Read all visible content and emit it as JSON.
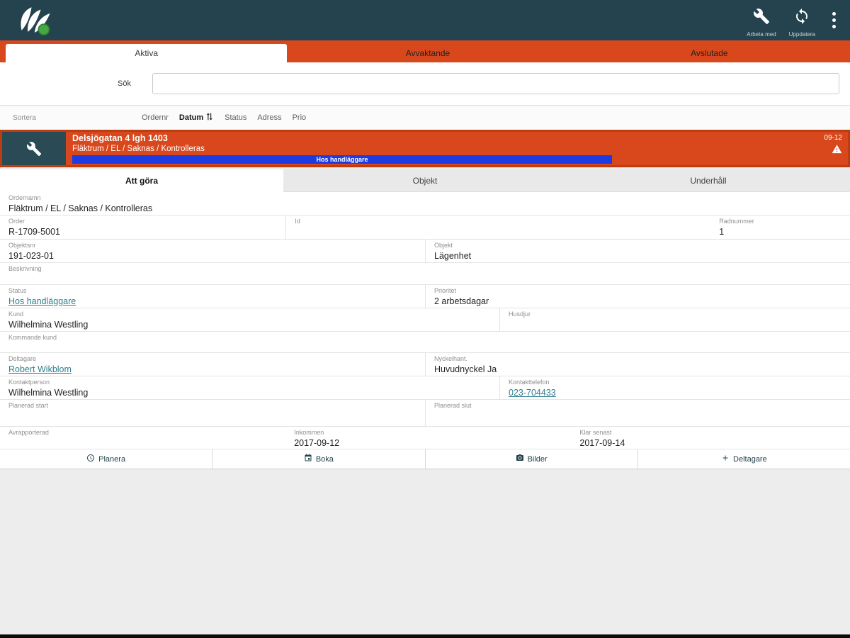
{
  "topbar": {
    "actions": [
      {
        "label": "Arbeta med",
        "icon": "wrench-icon"
      },
      {
        "label": "Uppdatera",
        "icon": "refresh-icon"
      }
    ]
  },
  "tabs": [
    {
      "label": "Aktiva",
      "active": true
    },
    {
      "label": "Avvaktande",
      "active": false
    },
    {
      "label": "Avslutade",
      "active": false
    }
  ],
  "search": {
    "label": "Sök",
    "value": ""
  },
  "sort": {
    "label": "Sortera",
    "options": [
      {
        "label": "Ordernr",
        "active": false
      },
      {
        "label": "Datum",
        "active": true
      },
      {
        "label": "Status",
        "active": false
      },
      {
        "label": "Adress",
        "active": false
      },
      {
        "label": "Prio",
        "active": false
      }
    ]
  },
  "order_card": {
    "title": "Delsjögatan 4 lgh 1403",
    "subtitle": "Fläktrum / EL / Saknas / Kontrolleras",
    "status_bar": "Hos handläggare",
    "date": "09-12"
  },
  "detail_tabs": [
    {
      "label": "Att göra",
      "active": true
    },
    {
      "label": "Objekt",
      "active": false
    },
    {
      "label": "Underhåll",
      "active": false
    }
  ],
  "fields": {
    "ordernamn": {
      "label": "Ordernamn",
      "value": "Fläktrum / EL / Saknas / Kontrolleras"
    },
    "order": {
      "label": "Order",
      "value": "R-1709-5001"
    },
    "id": {
      "label": "Id",
      "value": ""
    },
    "radnummer": {
      "label": "Radnummer",
      "value": "1"
    },
    "objektsnr": {
      "label": "Objektsnr",
      "value": "191-023-01"
    },
    "objekt": {
      "label": "Objekt",
      "value": "Lägenhet"
    },
    "beskrivning": {
      "label": "Beskrivning",
      "value": ""
    },
    "status": {
      "label": "Status",
      "value": "Hos handläggare"
    },
    "prioritet": {
      "label": "Prioritet",
      "value": "2 arbetsdagar"
    },
    "kund": {
      "label": "Kund",
      "value": "Wilhelmina Westling"
    },
    "husdjur": {
      "label": "Husdjur",
      "value": ""
    },
    "kommande_kund": {
      "label": "Kommande kund",
      "value": ""
    },
    "deltagare": {
      "label": "Deltagare",
      "value": "Robert Wikblom"
    },
    "nyckelhant": {
      "label": "Nyckelhant.",
      "value": "Huvudnyckel Ja"
    },
    "kontaktperson": {
      "label": "Kontaktperson",
      "value": "Wilhelmina Westling"
    },
    "kontakttelefon": {
      "label": "Kontakttelefon",
      "value": "023-704433"
    },
    "planerad_start": {
      "label": "Planerad start",
      "value": ""
    },
    "planerad_slut": {
      "label": "Planerad slut",
      "value": ""
    },
    "avrapporterad": {
      "label": "Avrapporterad",
      "value": ""
    },
    "inkommen": {
      "label": "Inkommen",
      "value": "2017-09-12"
    },
    "klar_senast": {
      "label": "Klar senast",
      "value": "2017-09-14"
    }
  },
  "action_buttons": [
    {
      "label": "Planera",
      "icon": "clock-icon"
    },
    {
      "label": "Boka",
      "icon": "calendar-icon"
    },
    {
      "label": "Bilder",
      "icon": "camera-icon"
    },
    {
      "label": "Deltagare",
      "icon": "plus-icon"
    }
  ],
  "colors": {
    "topbar": "#24434E",
    "accent_orange": "#D8481C",
    "progress_blue": "#1D3BE1",
    "link_teal": "#2F7F8E"
  }
}
